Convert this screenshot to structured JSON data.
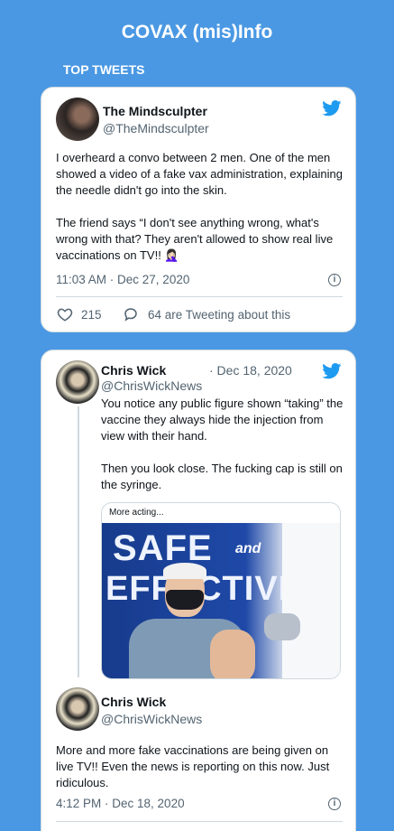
{
  "header": {
    "title": "COVAX (mis)Info",
    "section": "TOP TWEETS"
  },
  "tweet1": {
    "name": "The Mindsculpter",
    "handle": "@TheMindsculpter",
    "text": "I overheard a convo between 2 men. One of the men showed a video of a fake vax administration, explaining the needle didn't go into the skin.\n\nThe friend says “I don't see anything wrong, what's wrong with that? They aren't allowed to show real live vaccinations on TV!! 🤦🏻‍♀️",
    "timestamp": "11:03 AM · Dec 27, 2020",
    "likes": "215",
    "retweet_info": "64 are Tweeting about this"
  },
  "tweet2": {
    "name": "Chris Wick",
    "handle": "@ChrisWickNews",
    "date": "· Dec 18, 2020",
    "text": "You notice any public figure shown “taking” the vaccine they always hide the injection from view with their hand.\n\nThen you look close. The fucking cap is still on the syringe.",
    "media_caption": "More acting...",
    "media_text_1": "SAFE",
    "media_text_2": "and",
    "media_text_3": "EFFECTIVE"
  },
  "tweet3": {
    "name": "Chris Wick",
    "handle": "@ChrisWickNews",
    "text": "More and more fake vaccinations are being given on live TV!! Even the news is reporting on this now. Just ridiculous.",
    "timestamp": "4:12 PM · Dec 18, 2020"
  },
  "colors": {
    "background": "#4a98e3",
    "twitter_blue": "#1d9bf0"
  }
}
